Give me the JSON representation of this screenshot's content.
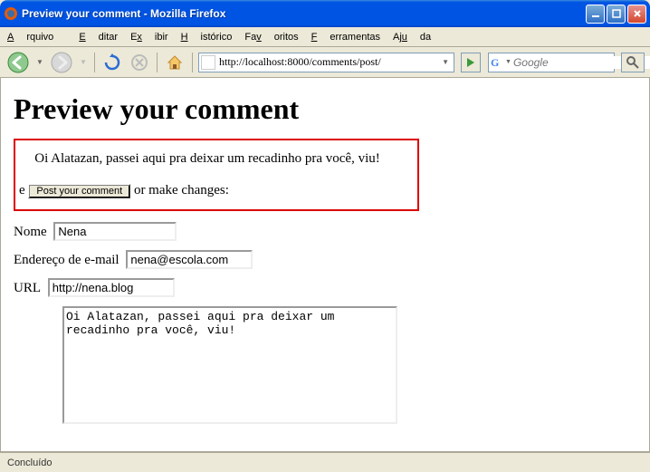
{
  "window": {
    "title": "Preview your comment - Mozilla Firefox"
  },
  "menu": {
    "arquivo": "Arquivo",
    "editar": "Editar",
    "exibir": "Exibir",
    "historico": "Histórico",
    "favoritos": "Favoritos",
    "ferramentas": "Ferramentas",
    "ajuda": "Ajuda"
  },
  "toolbar": {
    "url": "http://localhost:8000/comments/post/",
    "search_placeholder": "Google"
  },
  "page": {
    "heading": "Preview your comment",
    "preview_text": "Oi Alatazan, passei aqui pra deixar um recadinho pra você, viu!",
    "action_prefix": "e",
    "post_button": "Post your comment",
    "action_suffix": "or make changes:",
    "labels": {
      "nome": "Nome",
      "email": "Endereço de e-mail",
      "url": "URL"
    },
    "fields": {
      "nome": "Nena",
      "email": "nena@escola.com",
      "url": "http://nena.blog",
      "comment": "Oi Alatazan, passei aqui pra deixar um recadinho pra você, viu!"
    }
  },
  "status": {
    "text": "Concluído"
  }
}
